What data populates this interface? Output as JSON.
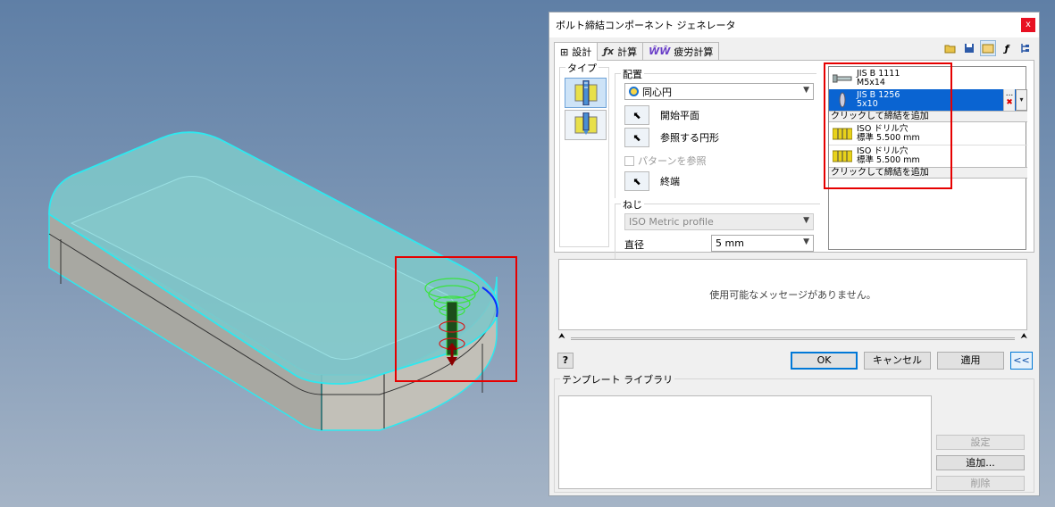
{
  "window": {
    "title": "ボルト締結コンポーネント ジェネレータ",
    "close_glyph": "x"
  },
  "tabs": [
    {
      "label": "設計",
      "icon": "design-icon",
      "glyph": "⊞"
    },
    {
      "label": "計算",
      "icon": "function-icon",
      "glyph": "ƒx"
    },
    {
      "label": "疲労計算",
      "icon": "fatigue-icon",
      "glyph": "ŴŴ"
    }
  ],
  "toolbar": [
    "open-folder-icon",
    "save-icon",
    "preferences-icon",
    "formula-icon",
    "tree-icon"
  ],
  "type_group": {
    "label": "タイプ"
  },
  "placement": {
    "label": "配置",
    "mode": "同心円",
    "start_plane": "開始平面",
    "ref_circle": "参照する円形",
    "follow_pattern": "パターンを参照",
    "end": "終端"
  },
  "thread": {
    "label": "ねじ",
    "type": "ISO Metric profile",
    "diameter_label": "直径",
    "diameter": "5 mm"
  },
  "fasteners": [
    {
      "line1": "JIS B 1111",
      "line2": "M5x14",
      "icon": "screw-icon",
      "selected": false
    },
    {
      "line1": "JIS B 1256",
      "line2": "5x10",
      "icon": "washer-icon",
      "selected": true
    },
    {
      "add": "クリックして締結を追加"
    },
    {
      "line1": "ISO ドリル穴",
      "line2": "標準 5.500 mm",
      "icon": "drill-hole-icon",
      "selected": false
    },
    {
      "line1": "ISO ドリル穴",
      "line2": "標準 5.500 mm",
      "icon": "drill-hole-icon",
      "selected": false
    },
    {
      "add": "クリックして締結を追加"
    }
  ],
  "fastener_side": {
    "more": "...",
    "delete_glyph": "✖",
    "dropdown_glyph": "▾"
  },
  "message": "使用可能なメッセージがありません。",
  "buttons": {
    "help": "?",
    "ok": "OK",
    "cancel": "キャンセル",
    "apply": "適用",
    "collapse": "<<"
  },
  "template_library": {
    "label": "テンプレート ライブラリ",
    "settings": "設定",
    "add": "追加...",
    "delete": "削除"
  },
  "colors": {
    "highlight": "#e60000",
    "selection": "#0a64d2",
    "part_top": "#7ec6c9",
    "part_edge": "#2ee8ef"
  }
}
